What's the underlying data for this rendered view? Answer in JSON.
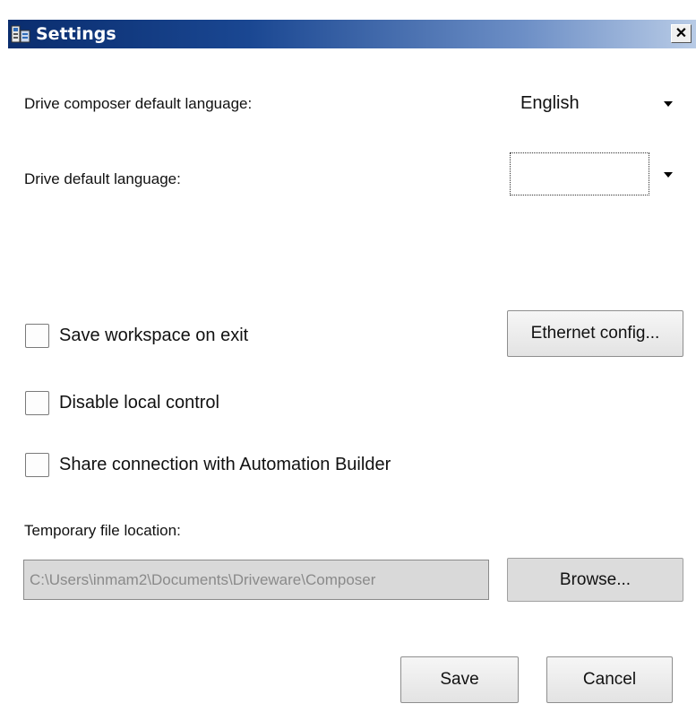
{
  "window": {
    "title": "Settings"
  },
  "title_bar": {
    "app_icon": "drive-composer-icon",
    "close_icon": "close-icon",
    "close_glyph": "✕"
  },
  "language": {
    "composer_label": "Drive composer default language:",
    "composer_value": "English",
    "drive_label": "Drive default language:",
    "drive_value": ""
  },
  "options": {
    "save_workspace": {
      "label": "Save workspace on exit",
      "checked": false
    },
    "disable_local_control": {
      "label": "Disable local control",
      "checked": false
    },
    "share_connection": {
      "label": "Share connection with Automation Builder",
      "checked": false
    }
  },
  "ethernet_button": "Ethernet config...",
  "temp_file": {
    "label": "Temporary file location:",
    "path": "C:\\Users\\inmam2\\Documents\\Driveware\\Composer",
    "browse_label": "Browse..."
  },
  "footer": {
    "save_label": "Save",
    "cancel_label": "Cancel"
  },
  "colors": {
    "title_bar_start": "#0a2d6e",
    "title_bar_end": "#b8cbe6"
  }
}
